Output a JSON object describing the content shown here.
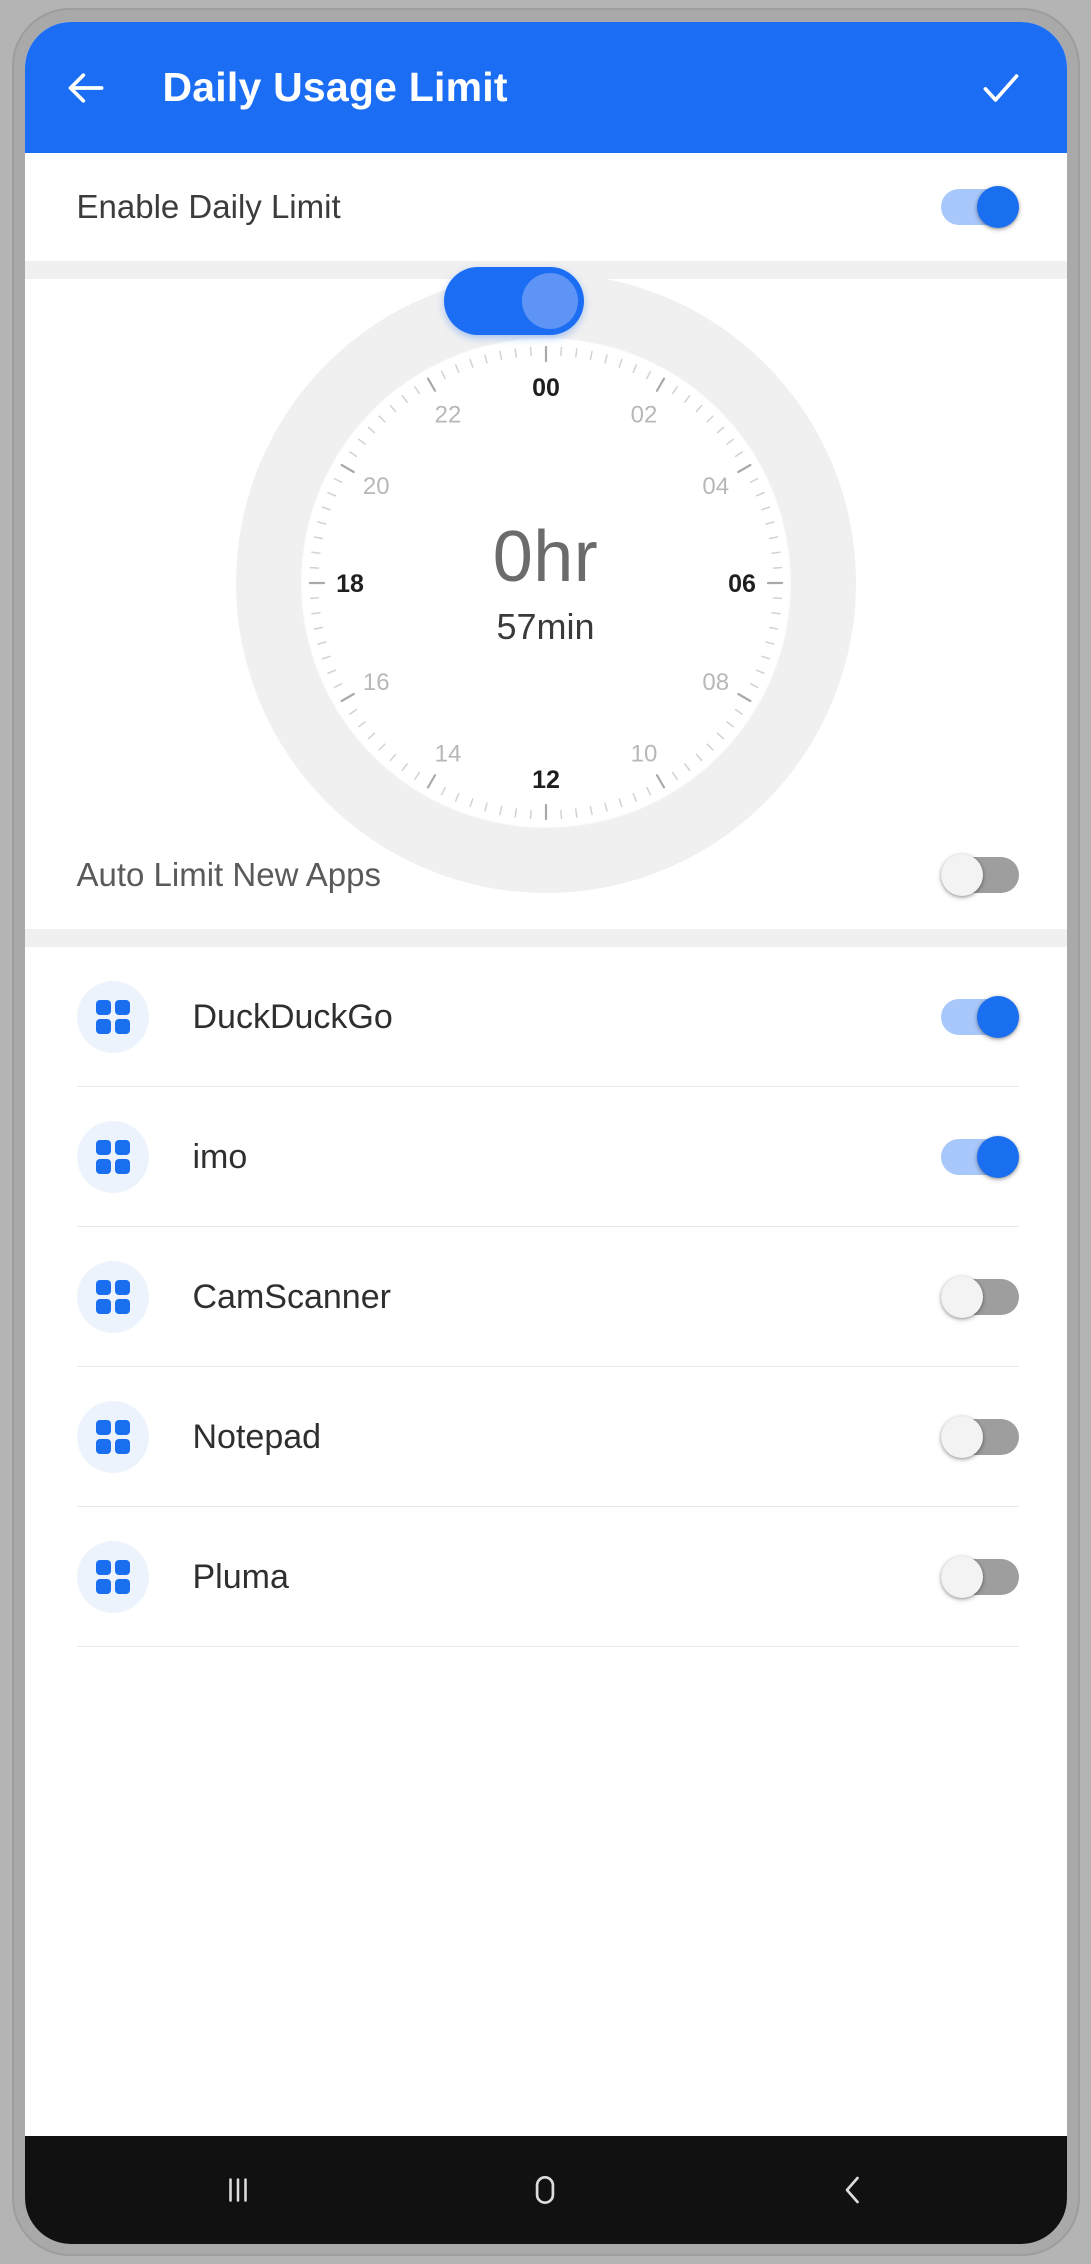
{
  "appbar": {
    "back_icon": "arrow-left-icon",
    "title": "Daily Usage Limit",
    "confirm_icon": "check-icon",
    "background": "#1b6ef3",
    "text_color": "#ffffff"
  },
  "settings": {
    "enable_daily_limit": {
      "label": "Enable Daily Limit",
      "state": "on"
    },
    "auto_limit_new_apps": {
      "label": "Auto Limit New Apps",
      "state": "off"
    }
  },
  "dial": {
    "hours_text": "0hr",
    "minutes_text": "57min",
    "hour_labels": [
      "00",
      "02",
      "04",
      "06",
      "08",
      "10",
      "12",
      "14",
      "16",
      "18",
      "20",
      "22"
    ],
    "major_labels": [
      "00",
      "06",
      "12",
      "18"
    ],
    "thumb_position_hour": "00",
    "track_color": "#f0f0f0",
    "thumb_color": "#1b6ef3",
    "face_color": "#ffffff"
  },
  "apps": [
    {
      "name": "DuckDuckGo",
      "icon": "app-grid-icon",
      "state": "on"
    },
    {
      "name": "imo",
      "icon": "app-grid-icon",
      "state": "on"
    },
    {
      "name": "CamScanner",
      "icon": "app-grid-icon",
      "state": "off"
    },
    {
      "name": "Notepad",
      "icon": "app-grid-icon",
      "state": "off"
    },
    {
      "name": "Pluma",
      "icon": "app-grid-icon",
      "state": "off"
    }
  ],
  "navbar": {
    "recents_icon": "recents-icon",
    "home_icon": "home-icon",
    "back_icon": "back-chevron-icon"
  },
  "colors": {
    "accent": "#1b6ef3",
    "toggle_on_track": "#a8c7fa",
    "toggle_on_knob": "#1a6ef0",
    "toggle_off_track": "#9e9e9e",
    "toggle_off_knob": "#f3f3f3",
    "app_icon_bg": "#edf3fd",
    "divider": "#e8e8e8",
    "section_gap": "#f0f0f0",
    "navbar_bg": "#111111"
  }
}
